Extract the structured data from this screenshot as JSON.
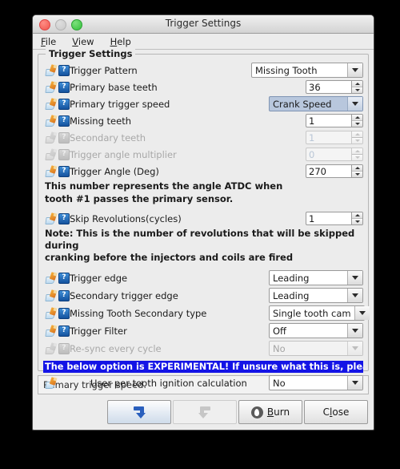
{
  "window": {
    "title": "Trigger Settings",
    "traffic_lights": [
      "close-button",
      "minimize-button",
      "maximize-button"
    ]
  },
  "menubar": {
    "items": [
      {
        "mnemonic": "F",
        "rest": "ile"
      },
      {
        "mnemonic": "V",
        "rest": "iew"
      },
      {
        "mnemonic": "H",
        "rest": "elp"
      }
    ]
  },
  "group": {
    "title": "Trigger Settings",
    "rows": [
      {
        "label": "Trigger Pattern",
        "type": "combo",
        "value": "Missing Tooth",
        "enabled": true,
        "focused": false
      },
      {
        "label": "Primary base teeth",
        "type": "spinner",
        "value": "36",
        "enabled": true
      },
      {
        "label": "Primary trigger speed",
        "type": "combo",
        "value": "Crank Speed",
        "enabled": true,
        "focused": true
      },
      {
        "label": "Missing teeth",
        "type": "spinner",
        "value": "1",
        "enabled": true
      },
      {
        "label": "Secondary teeth",
        "type": "spinner",
        "value": "1",
        "enabled": false
      },
      {
        "label": "Trigger angle multiplier",
        "type": "spinner",
        "value": "0",
        "enabled": false
      },
      {
        "label": "Trigger Angle (Deg)",
        "type": "spinner",
        "value": "270",
        "enabled": true
      }
    ],
    "note1_line1": "This number represents the angle ATDC when",
    "note1_line2": "tooth #1 passes the primary sensor.",
    "skip_row": {
      "label": "Skip Revolutions(cycles)",
      "value": "1",
      "enabled": true
    },
    "note2_line1": "Note: This is the number of revolutions that will be skipped during",
    "note2_line2": "cranking before the injectors and coils are fired",
    "rows2": [
      {
        "label": "Trigger edge",
        "value": "Leading",
        "enabled": true
      },
      {
        "label": "Secondary trigger edge",
        "value": "Leading",
        "enabled": true
      },
      {
        "label": "Missing Tooth Secondary type",
        "value": "Single tooth cam",
        "enabled": true
      },
      {
        "label": "Trigger Filter",
        "value": "Off",
        "enabled": true
      },
      {
        "label": "Re-sync every cycle",
        "value": "No",
        "enabled": false
      }
    ],
    "banner": "The below option is EXPERIMENTAL! If unsure what this is, please set to No",
    "experimental_row": {
      "label": "User per tooth ignition calculation",
      "value": "No",
      "enabled": true
    }
  },
  "status": {
    "text": "Primary trigger speed."
  },
  "buttons": {
    "undo": {
      "name": "undo-button",
      "enabled": true
    },
    "redo": {
      "name": "redo-button",
      "enabled": false
    },
    "burn": {
      "mnemonic": "B",
      "rest": "urn"
    },
    "close": {
      "pre": "C",
      "mnemonic": "l",
      "rest": "ose"
    }
  },
  "colors": {
    "banner_bg": "#1414e6",
    "focus_combo": "#b8c7dd",
    "window_bg": "#ececec"
  }
}
